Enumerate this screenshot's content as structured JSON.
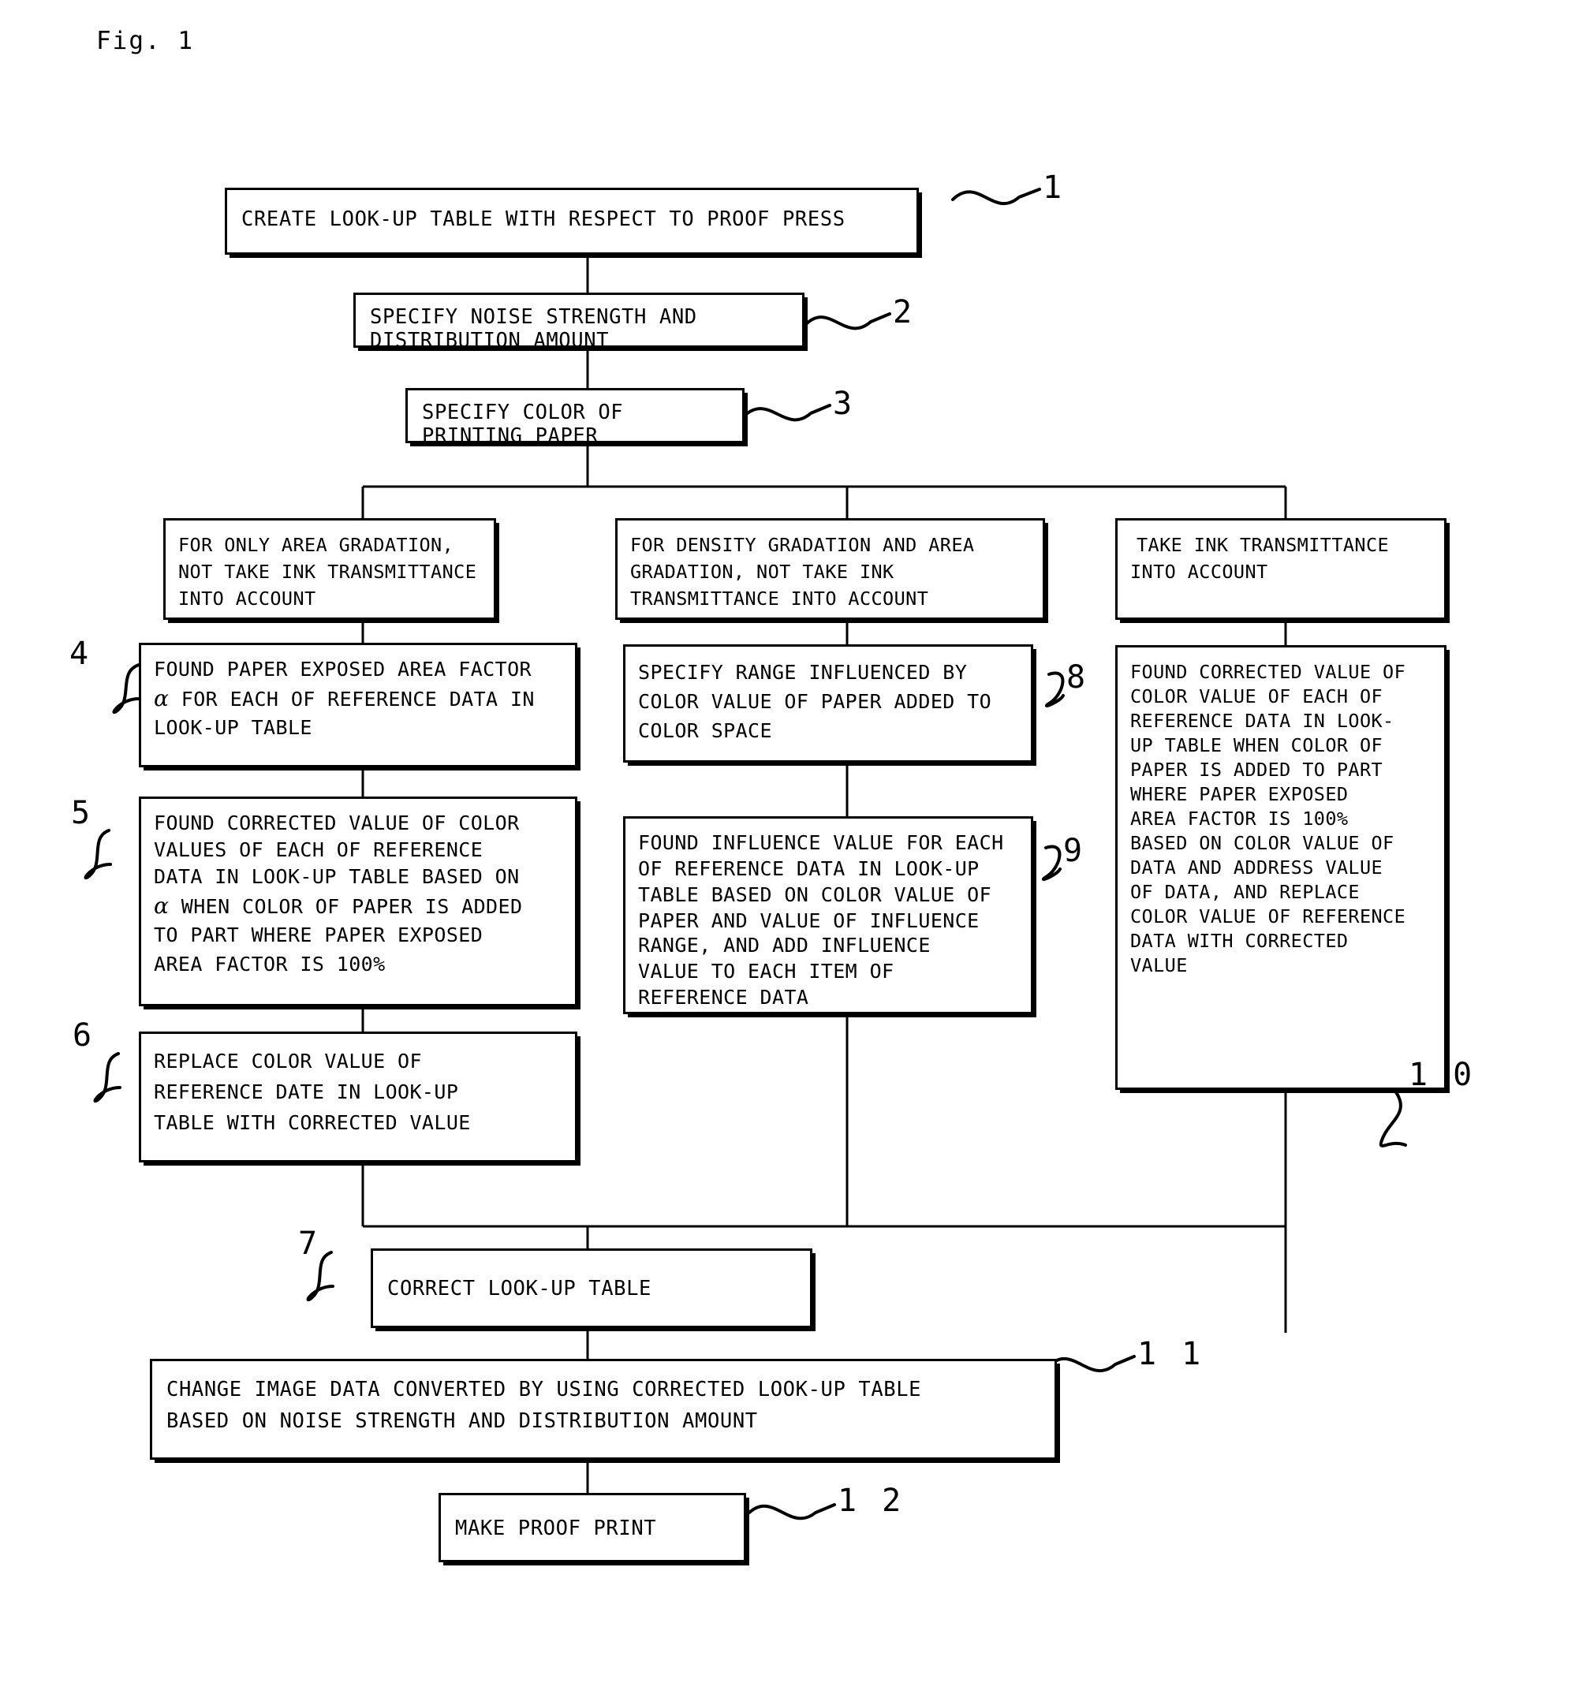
{
  "figure": {
    "label": "Fig. 1"
  },
  "boxes": [
    {
      "id": "b1",
      "ref": "1",
      "lines": [
        "CREATE LOOK-UP TABLE WITH RESPECT TO PROOF PRESS"
      ]
    },
    {
      "id": "b2",
      "ref": "2",
      "lines": [
        "SPECIFY NOISE STRENGTH AND",
        "DISTRIBUTION AMOUNT"
      ]
    },
    {
      "id": "b3",
      "ref": "3",
      "lines": [
        "SPECIFY COLOR OF",
        "PRINTING PAPER"
      ]
    },
    {
      "id": "bL",
      "ref": "",
      "lines": [
        "FOR ONLY AREA GRADATION,",
        "NOT TAKE INK TRANSMITTANCE",
        "INTO ACCOUNT"
      ]
    },
    {
      "id": "bM",
      "ref": "",
      "lines": [
        "FOR DENSITY GRADATION AND AREA",
        "GRADATION, NOT TAKE INK",
        "TRANSMITTANCE INTO ACCOUNT"
      ]
    },
    {
      "id": "bR",
      "ref": "",
      "lines": [
        "TAKE INK TRANSMITTANCE",
        "INTO ACCOUNT"
      ]
    },
    {
      "id": "b4",
      "ref": "4",
      "lines": [
        "FOUND PAPER EXPOSED AREA FACTOR",
        "α FOR EACH OF REFERENCE DATA IN",
        "LOOK-UP TABLE"
      ],
      "alpha_line": 1
    },
    {
      "id": "b5",
      "ref": "5",
      "lines": [
        "FOUND CORRECTED VALUE OF COLOR",
        "VALUES OF EACH OF REFERENCE",
        "DATA IN LOOK-UP TABLE BASED ON",
        "α WHEN COLOR OF PAPER IS ADDED",
        "TO PART WHERE PAPER EXPOSED",
        "AREA FACTOR IS 100%"
      ],
      "alpha_line": 3
    },
    {
      "id": "b6",
      "ref": "6",
      "lines": [
        "REPLACE COLOR VALUE OF",
        "REFERENCE DATE IN LOOK-UP",
        "TABLE WITH CORRECTED VALUE"
      ]
    },
    {
      "id": "b8",
      "ref": "8",
      "lines": [
        "SPECIFY RANGE INFLUENCED BY",
        "COLOR VALUE OF PAPER ADDED TO",
        "COLOR SPACE"
      ]
    },
    {
      "id": "b9",
      "ref": "9",
      "lines": [
        "FOUND INFLUENCE VALUE FOR EACH",
        "OF REFERENCE DATA IN LOOK-UP",
        "TABLE BASED ON COLOR VALUE OF",
        "PAPER AND VALUE OF INFLUENCE",
        "RANGE, AND ADD INFLUENCE",
        "VALUE TO EACH ITEM OF",
        "REFERENCE DATA"
      ]
    },
    {
      "id": "b10",
      "ref": "1 0",
      "lines": [
        "FOUND CORRECTED VALUE OF",
        "COLOR VALUE OF EACH OF",
        "REFERENCE DATA IN LOOK-",
        "UP TABLE WHEN COLOR OF",
        "PAPER IS ADDED TO PART",
        "WHERE PAPER EXPOSED",
        "AREA FACTOR IS 100%",
        "BASED ON COLOR VALUE OF",
        "DATA AND ADDRESS VALUE",
        "OF DATA, AND REPLACE",
        "COLOR VALUE OF REFERENCE",
        "DATA WITH CORRECTED",
        "VALUE"
      ]
    },
    {
      "id": "b7",
      "ref": "7",
      "lines": [
        "CORRECT LOOK-UP TABLE"
      ]
    },
    {
      "id": "b11",
      "ref": "1 1",
      "lines": [
        "CHANGE IMAGE DATA CONVERTED BY USING CORRECTED LOOK-UP TABLE",
        "BASED ON NOISE STRENGTH AND DISTRIBUTION AMOUNT"
      ]
    },
    {
      "id": "b12",
      "ref": "1 2",
      "lines": [
        "MAKE PROOF PRINT"
      ]
    }
  ],
  "refs": {
    "r1": "1",
    "r2": "2",
    "r3": "3",
    "r4": "4",
    "r5": "5",
    "r6": "6",
    "r7": "7",
    "r8": "8",
    "r9": "9",
    "r10": "1 0",
    "r11": "1 1",
    "r12": "1 2"
  }
}
